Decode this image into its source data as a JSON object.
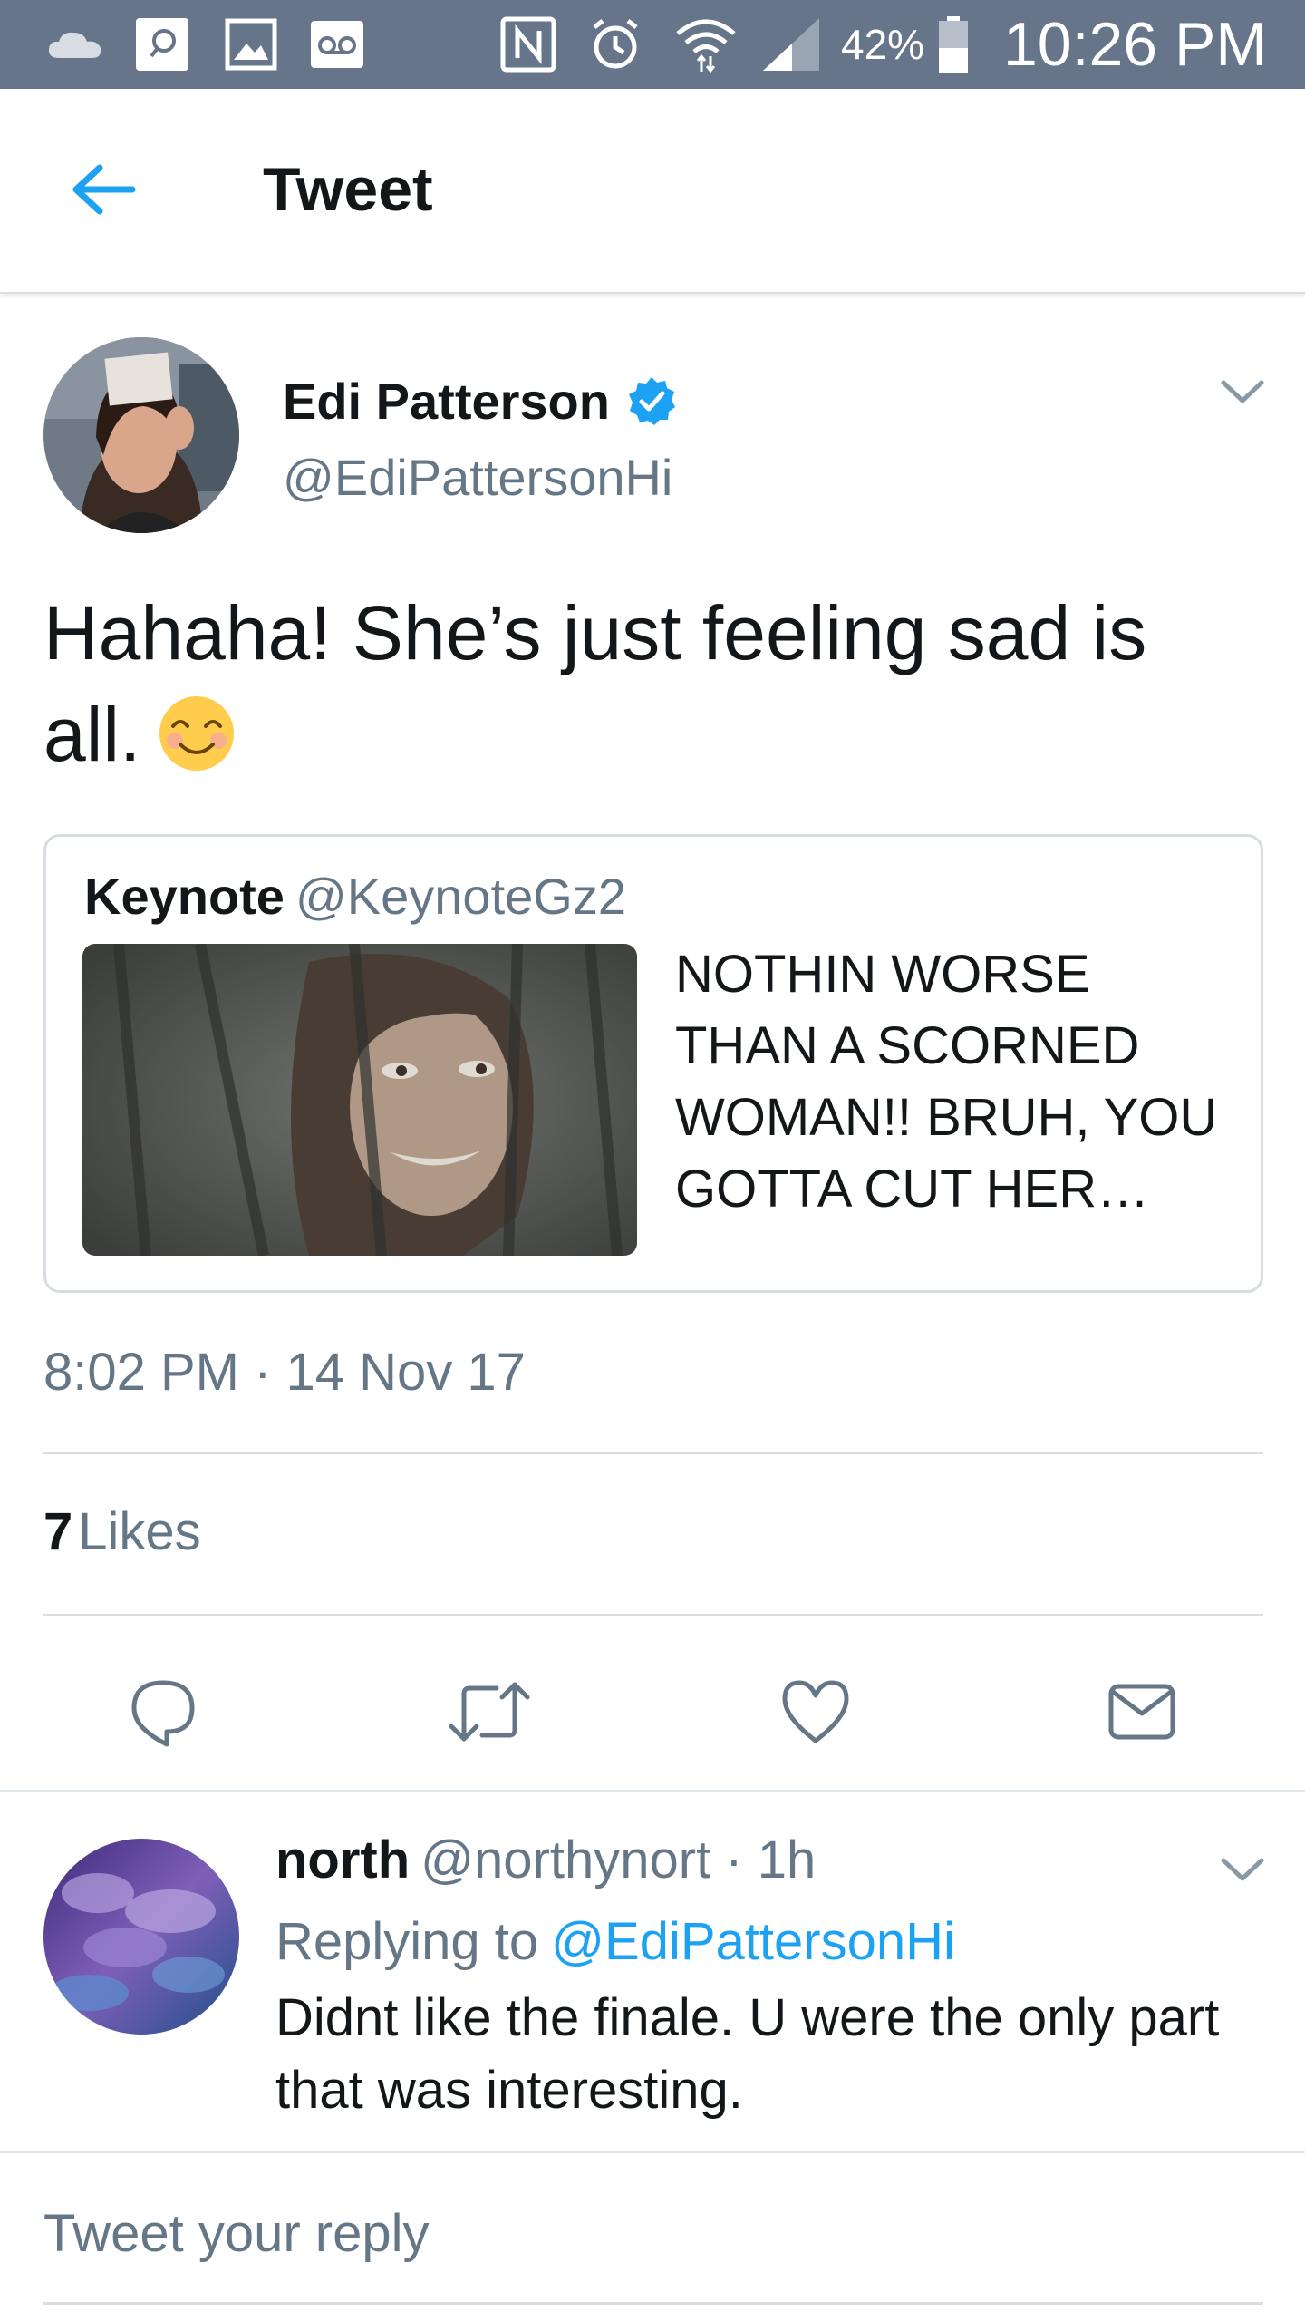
{
  "status_bar": {
    "battery_percent": "42%",
    "time": "10:26 PM",
    "icons": [
      "cloud-icon",
      "search-app-icon",
      "gallery-icon",
      "voicemail-icon",
      "nfc-icon",
      "alarm-icon",
      "wifi-icon",
      "signal-icon",
      "battery-icon"
    ]
  },
  "header": {
    "title": "Tweet"
  },
  "tweet": {
    "author_name": "Edi Patterson",
    "author_handle": "@EdiPattersonHi",
    "text": "Hahaha! She’s just feeling sad is all.",
    "quote": {
      "name": "Keynote",
      "handle": "@KeynoteGz2",
      "text": "NOTHIN WORSE THAN A SCORNED WOMAN!! BRUH, YOU GOTTA CUT HER…"
    },
    "timestamp": "8:02 PM · 14 Nov 17",
    "likes_count": "7",
    "likes_label": "Likes"
  },
  "reply": {
    "name": "north",
    "meta": "@northynort · 1h",
    "replying_prefix": "Replying to",
    "replying_handle": "@EdiPattersonHi",
    "text": "Didnt like the finale. U were the only part that was interesting."
  },
  "compose": {
    "placeholder": "Tweet your reply"
  },
  "colors": {
    "status_bar": "#66758a",
    "accent": "#1da1f2",
    "secondary_text": "#657786",
    "divider": "#d8dde2"
  }
}
